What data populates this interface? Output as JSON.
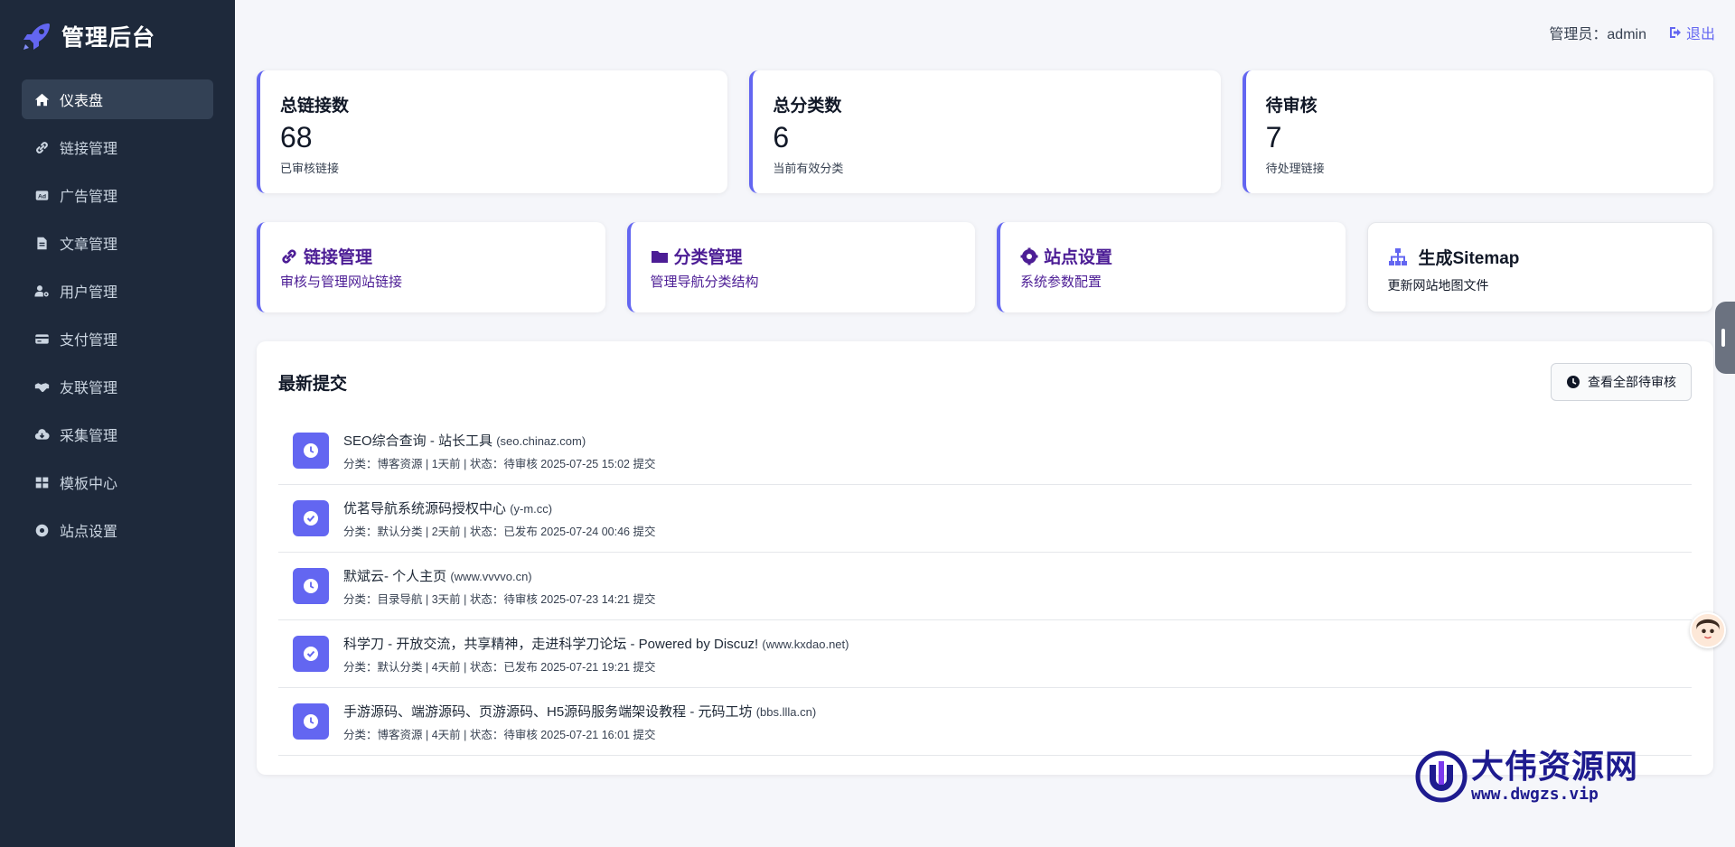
{
  "sidebar": {
    "brand": "管理后台",
    "items": [
      {
        "label": "仪表盘",
        "icon": "home-icon",
        "active": true
      },
      {
        "label": "链接管理",
        "icon": "link-icon"
      },
      {
        "label": "广告管理",
        "icon": "ad-icon"
      },
      {
        "label": "文章管理",
        "icon": "file-icon"
      },
      {
        "label": "用户管理",
        "icon": "user-gear-icon"
      },
      {
        "label": "支付管理",
        "icon": "credit-card-icon"
      },
      {
        "label": "友联管理",
        "icon": "handshake-icon"
      },
      {
        "label": "采集管理",
        "icon": "cloud-download-icon"
      },
      {
        "label": "模板中心",
        "icon": "grid-icon"
      },
      {
        "label": "站点设置",
        "icon": "gear-icon"
      }
    ]
  },
  "topbar": {
    "admin_label": "管理员：admin",
    "logout_label": "退出"
  },
  "stats": [
    {
      "label": "总链接数",
      "value": "68",
      "desc": "已审核链接"
    },
    {
      "label": "总分类数",
      "value": "6",
      "desc": "当前有效分类"
    },
    {
      "label": "待审核",
      "value": "7",
      "desc": "待处理链接"
    }
  ],
  "shortcuts": [
    {
      "title": "链接管理",
      "sub": "审核与管理网站链接",
      "icon": "link-icon"
    },
    {
      "title": "分类管理",
      "sub": "管理导航分类结构",
      "icon": "folder-icon"
    },
    {
      "title": "站点设置",
      "sub": "系统参数配置",
      "icon": "gear-icon"
    },
    {
      "title": "生成Sitemap",
      "sub": "更新网站地图文件",
      "icon": "sitemap-icon"
    }
  ],
  "recent": {
    "title": "最新提交",
    "view_all_label": "查看全部待审核",
    "items": [
      {
        "title": "SEO综合查询 - 站长工具",
        "domain": "(seo.chinaz.com)",
        "meta": "分类：博客资源 | 1天前 | 状态：待审核 2025-07-25 15:02 提交",
        "status_icon": "clock-icon"
      },
      {
        "title": "优茗导航系统源码授权中心",
        "domain": "(y-m.cc)",
        "meta": "分类：默认分类 | 2天前 | 状态：已发布 2025-07-24 00:46 提交",
        "status_icon": "check-circle-icon"
      },
      {
        "title": "默斌云- 个人主页",
        "domain": "(www.vvvvo.cn)",
        "meta": "分类：目录导航 | 3天前 | 状态：待审核 2025-07-23 14:21 提交",
        "status_icon": "clock-icon"
      },
      {
        "title": "科学刀 - 开放交流，共享精神，走进科学刀论坛 - Powered by Discuz!",
        "domain": "(www.kxdao.net)",
        "meta": "分类：默认分类 | 4天前 | 状态：已发布 2025-07-21 19:21 提交",
        "status_icon": "check-circle-icon"
      },
      {
        "title": "手游源码、端游源码、页游源码、H5源码服务端架设教程 - 元码工坊",
        "domain": "(bbs.llla.cn)",
        "meta": "分类：博客资源 | 4天前 | 状态：待审核 2025-07-21 16:01 提交",
        "status_icon": "clock-icon"
      }
    ]
  },
  "watermark": {
    "cn": "大伟资源网",
    "url": "www.dwgzs.vip"
  },
  "colors": {
    "sidebar_bg": "#1e293b",
    "accent": "#6366f1",
    "shortcut_text": "#4c1d95"
  }
}
